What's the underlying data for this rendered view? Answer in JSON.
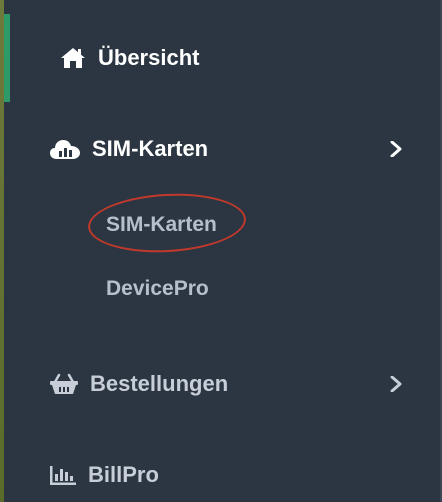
{
  "sidebar": {
    "items": [
      {
        "label": "Übersicht",
        "icon": "home-icon"
      },
      {
        "label": "SIM-Karten",
        "icon": "cloud-chart-icon",
        "expanded": true,
        "children": [
          {
            "label": "SIM-Karten"
          },
          {
            "label": "DevicePro"
          }
        ]
      },
      {
        "label": "Bestellungen",
        "icon": "basket-icon"
      },
      {
        "label": "BillPro",
        "icon": "bar-chart-icon"
      }
    ]
  },
  "colors": {
    "background": "#2b3642",
    "active_marker": "#2e9a6a",
    "annotation_ring": "#c0392b",
    "sub_item_text": "#b6c0cc"
  }
}
